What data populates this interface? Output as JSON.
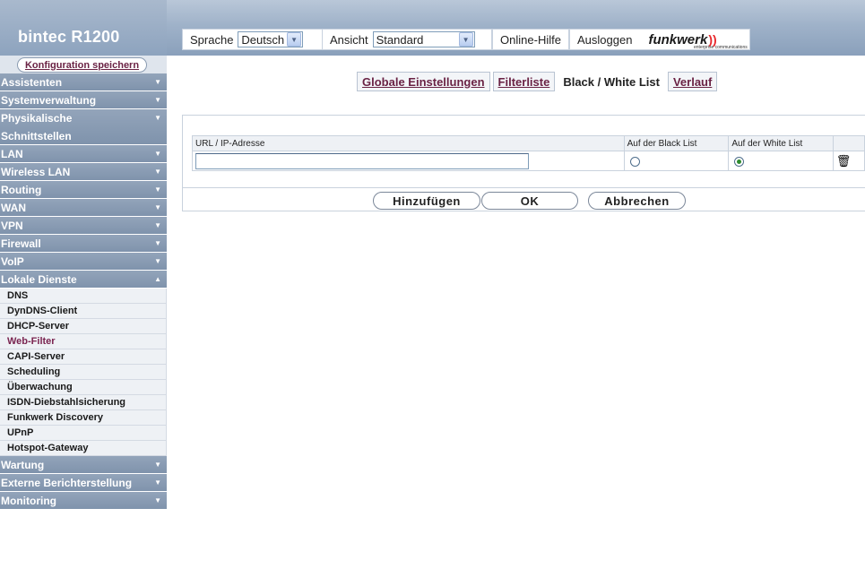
{
  "app": {
    "title": "bintec R1200"
  },
  "header": {
    "language_label": "Sprache",
    "language_value": "Deutsch",
    "view_label": "Ansicht",
    "view_value": "Standard",
    "help_label": "Online-Hilfe",
    "logout_label": "Ausloggen",
    "logo_text": "funkwerk",
    "logo_subtext": "enterprise communications",
    "logo_mark": "))"
  },
  "sidebar": {
    "save_label": "Konfiguration speichern",
    "menu_before": [
      {
        "label": "Assistenten",
        "arrow": "▼"
      },
      {
        "label": "Systemverwaltung",
        "arrow": "▼"
      }
    ],
    "physical": {
      "label_line1": "Physikalische",
      "label_line2": "Schnittstellen",
      "arrow": "▼"
    },
    "menu_middle": [
      {
        "label": "LAN",
        "arrow": "▼"
      },
      {
        "label": "Wireless LAN",
        "arrow": "▼"
      },
      {
        "label": "Routing",
        "arrow": "▼"
      },
      {
        "label": "WAN",
        "arrow": "▼"
      },
      {
        "label": "VPN",
        "arrow": "▼"
      },
      {
        "label": "Firewall",
        "arrow": "▼"
      },
      {
        "label": "VoIP",
        "arrow": "▼"
      },
      {
        "label": "Lokale Dienste",
        "arrow": "▲"
      }
    ],
    "sub_items": [
      {
        "label": "DNS"
      },
      {
        "label": "DynDNS-Client"
      },
      {
        "label": "DHCP-Server"
      },
      {
        "label": "Web-Filter"
      },
      {
        "label": "CAPI-Server"
      },
      {
        "label": "Scheduling"
      },
      {
        "label": "Überwachung"
      },
      {
        "label": "ISDN-Diebstahlsicherung"
      },
      {
        "label": "Funkwerk Discovery"
      },
      {
        "label": "UPnP"
      },
      {
        "label": "Hotspot-Gateway"
      }
    ],
    "active_sub": "Web-Filter",
    "menu_after": [
      {
        "label": "Wartung",
        "arrow": "▼"
      },
      {
        "label": "Externe Berichterstellung",
        "arrow": "▼"
      },
      {
        "label": "Monitoring",
        "arrow": "▼"
      }
    ]
  },
  "tabs": [
    {
      "label": "Globale Einstellungen"
    },
    {
      "label": "Filterliste"
    },
    {
      "label": "Black / White List"
    },
    {
      "label": "Verlauf"
    }
  ],
  "table": {
    "col_url": "URL / IP-Adresse",
    "col_black": "Auf der Black List",
    "col_white": "Auf der White List",
    "row": {
      "url_value": "",
      "black_selected": false,
      "white_selected": true,
      "delete_icon": "🗑"
    }
  },
  "buttons": {
    "add": "Hinzufügen",
    "ok": "OK",
    "cancel": "Abbrechen"
  }
}
